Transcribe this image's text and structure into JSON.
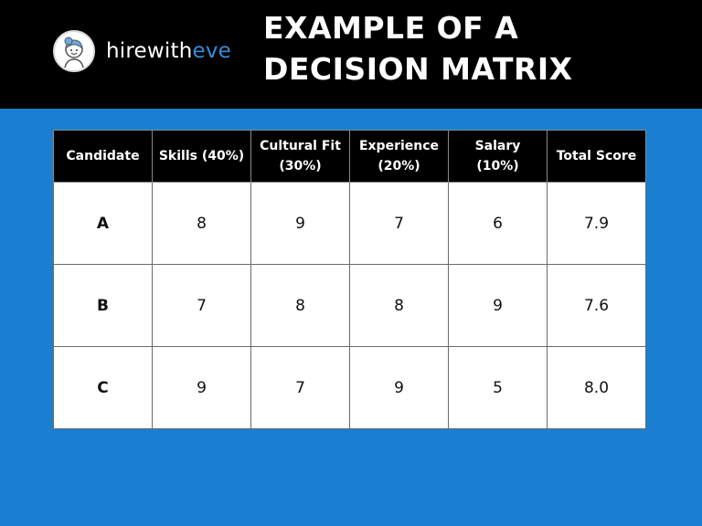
{
  "brand": {
    "name_main": "hirewith",
    "name_accent": "eve",
    "accent_color": "#3a8ad6"
  },
  "title": {
    "line1": "EXAMPLE OF A",
    "line2": "DECISION MATRIX"
  },
  "colors": {
    "background": "#1a7fd0",
    "header": "#000000"
  },
  "table": {
    "headers": [
      {
        "line1": "Candidate",
        "line2": ""
      },
      {
        "line1": "Skills (40%)",
        "line2": ""
      },
      {
        "line1": "Cultural Fit",
        "line2": "(30%)"
      },
      {
        "line1": "Experience",
        "line2": "(20%)"
      },
      {
        "line1": "Salary",
        "line2": "(10%)"
      },
      {
        "line1": "Total Score",
        "line2": ""
      }
    ],
    "rows": [
      [
        "A",
        "8",
        "9",
        "7",
        "6",
        "7.9"
      ],
      [
        "B",
        "7",
        "8",
        "8",
        "9",
        "7.6"
      ],
      [
        "C",
        "9",
        "7",
        "9",
        "5",
        "8.0"
      ]
    ]
  }
}
